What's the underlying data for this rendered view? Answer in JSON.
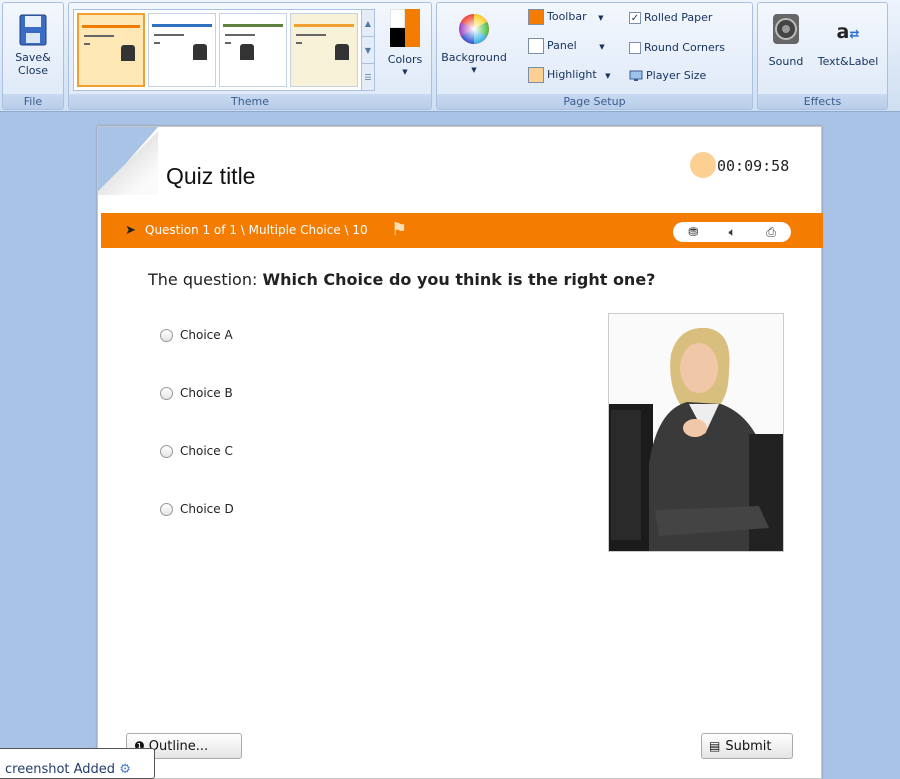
{
  "ribbon": {
    "file": {
      "save_close": [
        "Save&",
        "Close"
      ],
      "label": "File"
    },
    "theme": {
      "label": "Theme",
      "colors_label": "Colors"
    },
    "page_setup": {
      "label": "Page Setup",
      "background_label": "Background",
      "toolbar_label": "Toolbar",
      "panel_label": "Panel",
      "highlight_label": "Highlight",
      "rolled_paper_label": "Rolled Paper",
      "rolled_paper_checked": true,
      "round_corners_label": "Round Corners",
      "round_corners_checked": false,
      "player_size_label": "Player Size",
      "toolbar_color": "#f47c00",
      "panel_color": "#ffffff",
      "highlight_color": "#fccf92"
    },
    "effects": {
      "label": "Effects",
      "sound_label": "Sound",
      "text_label": "Text&Label"
    }
  },
  "quiz": {
    "title": "Quiz title",
    "timer": "00:09:58",
    "question_meta": "Question 1 of 1 \\ Multiple Choice \\ 10",
    "question_prefix": "The question: ",
    "question_text": "Which Choice do you think is the right one?",
    "choices": [
      "Choice A",
      "Choice B",
      "Choice C",
      "Choice D"
    ],
    "outline_label": "Outline...",
    "submit_label": "Submit",
    "accent_color": "#f47c00"
  },
  "toast": {
    "text": "creenshot Added"
  }
}
